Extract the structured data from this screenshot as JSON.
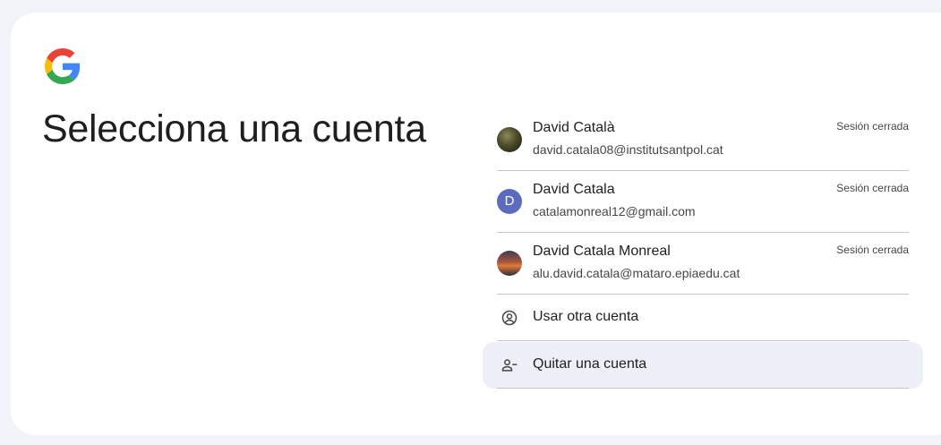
{
  "page": {
    "title": "Selecciona una cuenta"
  },
  "accounts": [
    {
      "name": "David Català",
      "email": "david.catala08@institutsantpol.cat",
      "status": "Sesión cerrada",
      "avatar": "photo"
    },
    {
      "name": "David Catala",
      "email": "catalamonreal12@gmail.com",
      "status": "Sesión cerrada",
      "avatar_letter": "D"
    },
    {
      "name": "David Catala Monreal",
      "email": "alu.david.catala@mataro.epiaedu.cat",
      "status": "Sesión cerrada",
      "avatar": "photo"
    }
  ],
  "actions": {
    "use_other": "Usar otra cuenta",
    "remove": "Quitar una cuenta"
  },
  "icons": {
    "logo": "google-logo-icon",
    "use_other": "account-circle-icon",
    "remove": "person-remove-icon"
  },
  "colors": {
    "background": "#f0f4f9",
    "card": "#ffffff",
    "avatar_letter_bg": "#5c6bc0",
    "highlight": "#edf1f7",
    "divider": "#c4c7c5"
  }
}
